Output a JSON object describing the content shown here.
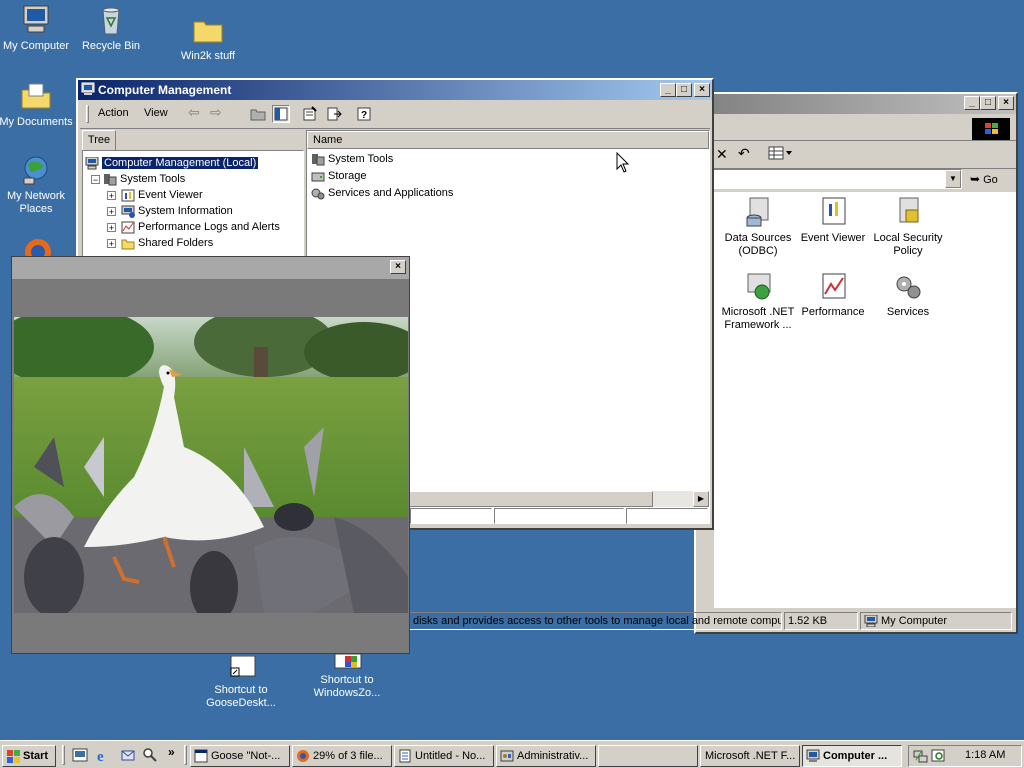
{
  "desktop": {
    "icons": [
      {
        "label": "My Computer"
      },
      {
        "label": "Recycle Bin"
      },
      {
        "label": "Win2k stuff"
      },
      {
        "label": "My Documents"
      },
      {
        "label": "My Network Places"
      },
      {
        "label": "Shortcut to GooseDeskt..."
      },
      {
        "label": "Shortcut to WindowsZo..."
      }
    ]
  },
  "comp_mgmt": {
    "title": "Computer Management",
    "menu": {
      "action": "Action",
      "view": "View"
    },
    "tab": "Tree",
    "column_header": "Name",
    "tree": [
      {
        "label": "Computer Management (Local)"
      },
      {
        "label": "System Tools"
      },
      {
        "label": "Event Viewer"
      },
      {
        "label": "System Information"
      },
      {
        "label": "Performance Logs and Alerts"
      },
      {
        "label": "Shared Folders"
      }
    ],
    "list": [
      {
        "label": "System Tools"
      },
      {
        "label": "Storage"
      },
      {
        "label": "Services and Applications"
      }
    ]
  },
  "admin_tools": {
    "go_label": "Go",
    "icons": [
      {
        "label": "Data Sources (ODBC)"
      },
      {
        "label": "Event Viewer"
      },
      {
        "label": "Local Security Policy"
      },
      {
        "label": "Microsoft .NET Framework ..."
      },
      {
        "label": "Performance"
      },
      {
        "label": "Services"
      }
    ],
    "status": {
      "description": "disks and provides access to other tools to manage local and remote comput",
      "size": "1.52 KB",
      "zone": "My Computer"
    }
  },
  "taskbar": {
    "start": "Start",
    "buttons": [
      {
        "label": "Goose \"Not-..."
      },
      {
        "label": "29% of 3 file..."
      },
      {
        "label": "Untitled - No..."
      },
      {
        "label": "Administrativ..."
      },
      {
        "label": ""
      },
      {
        "label": "Microsoft .NET F..."
      },
      {
        "label": "Computer ..."
      }
    ],
    "chevron": "»",
    "clock": "1:18 AM"
  },
  "colors": {
    "desktop": "#3a6ea5",
    "titlebar_active": "#0a246a",
    "face": "#d4d0c8"
  }
}
